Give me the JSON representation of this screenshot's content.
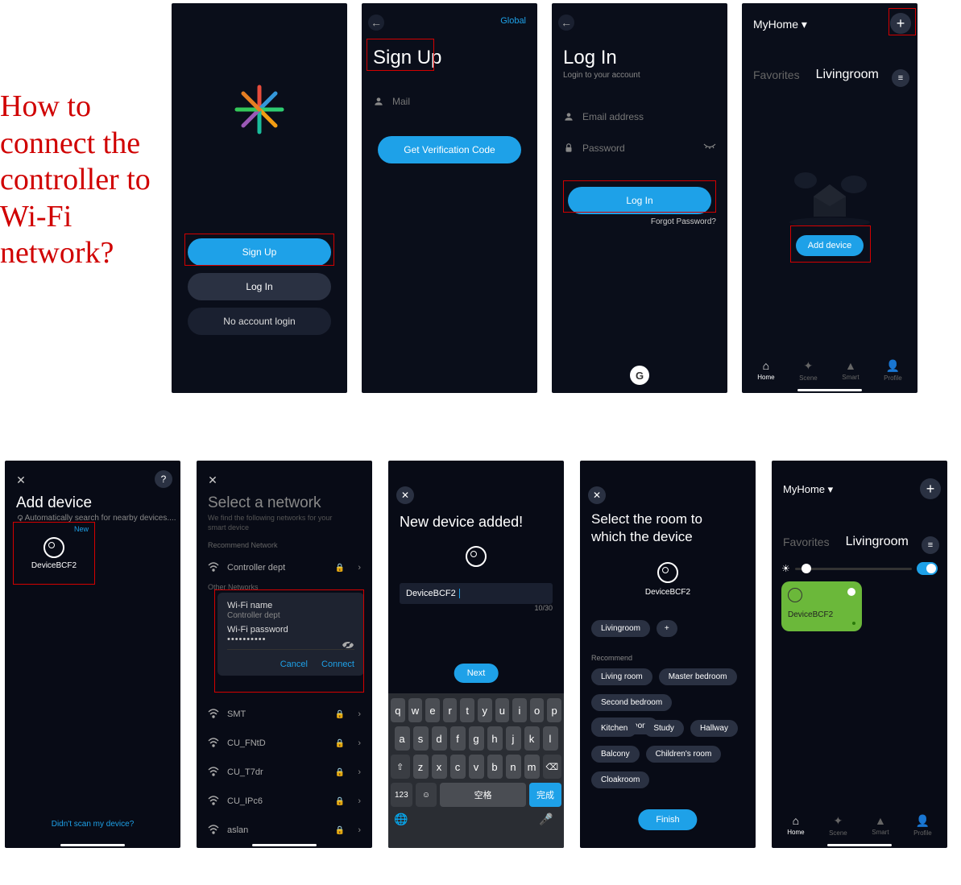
{
  "title": "How to connect the controller to Wi-Fi network?",
  "s1": {
    "signup": "Sign Up",
    "login": "Log In",
    "guest": "No account login"
  },
  "s2": {
    "global": "Global",
    "title": "Sign Up",
    "mail": "Mail",
    "getcode": "Get Verification Code"
  },
  "s3": {
    "title": "Log In",
    "sub": "Login to your account",
    "email": "Email address",
    "pass": "Password",
    "login": "Log In",
    "forgot": "Forgot Password?"
  },
  "s4": {
    "home": "MyHome ▾",
    "fav": "Favorites",
    "room": "Livingroom",
    "add": "Add device",
    "nav": [
      "Home",
      "Scene",
      "Smart",
      "Profile"
    ]
  },
  "s5": {
    "title": "Add device",
    "sub": "Automatically search for nearby devices....",
    "new": "New",
    "dev": "DeviceBCF2",
    "link": "Didn't scan my device?"
  },
  "s6": {
    "title": "Select a network",
    "sub": "We find the following networks for your smart device",
    "rec": "Recommend Network",
    "other": "Other Networks",
    "nets": [
      "Controller dept",
      "SMT",
      "CU_FNtD",
      "CU_T7dr",
      "CU_IPc6",
      "aslan"
    ],
    "dlg": {
      "name_lbl": "Wi-Fi name",
      "name_val": "Controller dept",
      "pass_lbl": "Wi-Fi password",
      "pass_val": "••••••••••",
      "cancel": "Cancel",
      "connect": "Connect"
    }
  },
  "s7": {
    "title": "New device added!",
    "dev": "DeviceBCF2",
    "count": "10/30",
    "next": "Next",
    "kb": {
      "r1": [
        "q",
        "w",
        "e",
        "r",
        "t",
        "y",
        "u",
        "i",
        "o",
        "p"
      ],
      "r2": [
        "a",
        "s",
        "d",
        "f",
        "g",
        "h",
        "j",
        "k",
        "l"
      ],
      "r3": [
        "z",
        "x",
        "c",
        "v",
        "b",
        "n",
        "m"
      ],
      "num": "123",
      "space": "空格",
      "done": "完成"
    }
  },
  "s8": {
    "title": "Select the room to which the device",
    "dev": "DeviceBCF2",
    "selected": "Livingroom",
    "rec": "Recommend",
    "rooms": [
      "Living room",
      "Master bedroom",
      "Second bedroom",
      "Dinning room",
      "Kitchen",
      "Study",
      "Hallway",
      "Balcony",
      "Children's room",
      "Cloakroom"
    ],
    "finish": "Finish"
  },
  "s9": {
    "home": "MyHome ▾",
    "fav": "Favorites",
    "room": "Livingroom",
    "tile": "DeviceBCF2",
    "nav": [
      "Home",
      "Scene",
      "Smart",
      "Profile"
    ]
  }
}
